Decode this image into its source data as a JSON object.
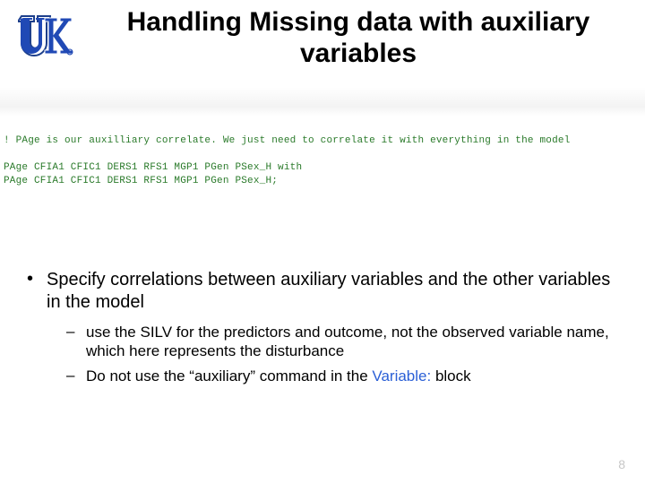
{
  "logo": {
    "alt": "UK University of Kentucky logo"
  },
  "title": "Handling Missing data with auxiliary variables",
  "code": {
    "comment": "! PAge is our auxilliary correlate. We just need to correlate it with everything in the model",
    "line1": "PAge CFIA1 CFIC1 DERS1 RFS1 MGP1 PGen PSex_H with",
    "line2": "PAge CFIA1 CFIC1 DERS1 RFS1 MGP1 PGen PSex_H;"
  },
  "bullet": {
    "main": "Specify correlations between auxiliary variables and the other variables in the model",
    "sub": [
      "use the SILV for the predictors and outcome, not the observed variable name, which here represents the disturbance",
      {
        "pre": "Do not use the “auxiliary” command in the ",
        "kw": "Variable:",
        "post": " block"
      }
    ]
  },
  "page_number": "8"
}
